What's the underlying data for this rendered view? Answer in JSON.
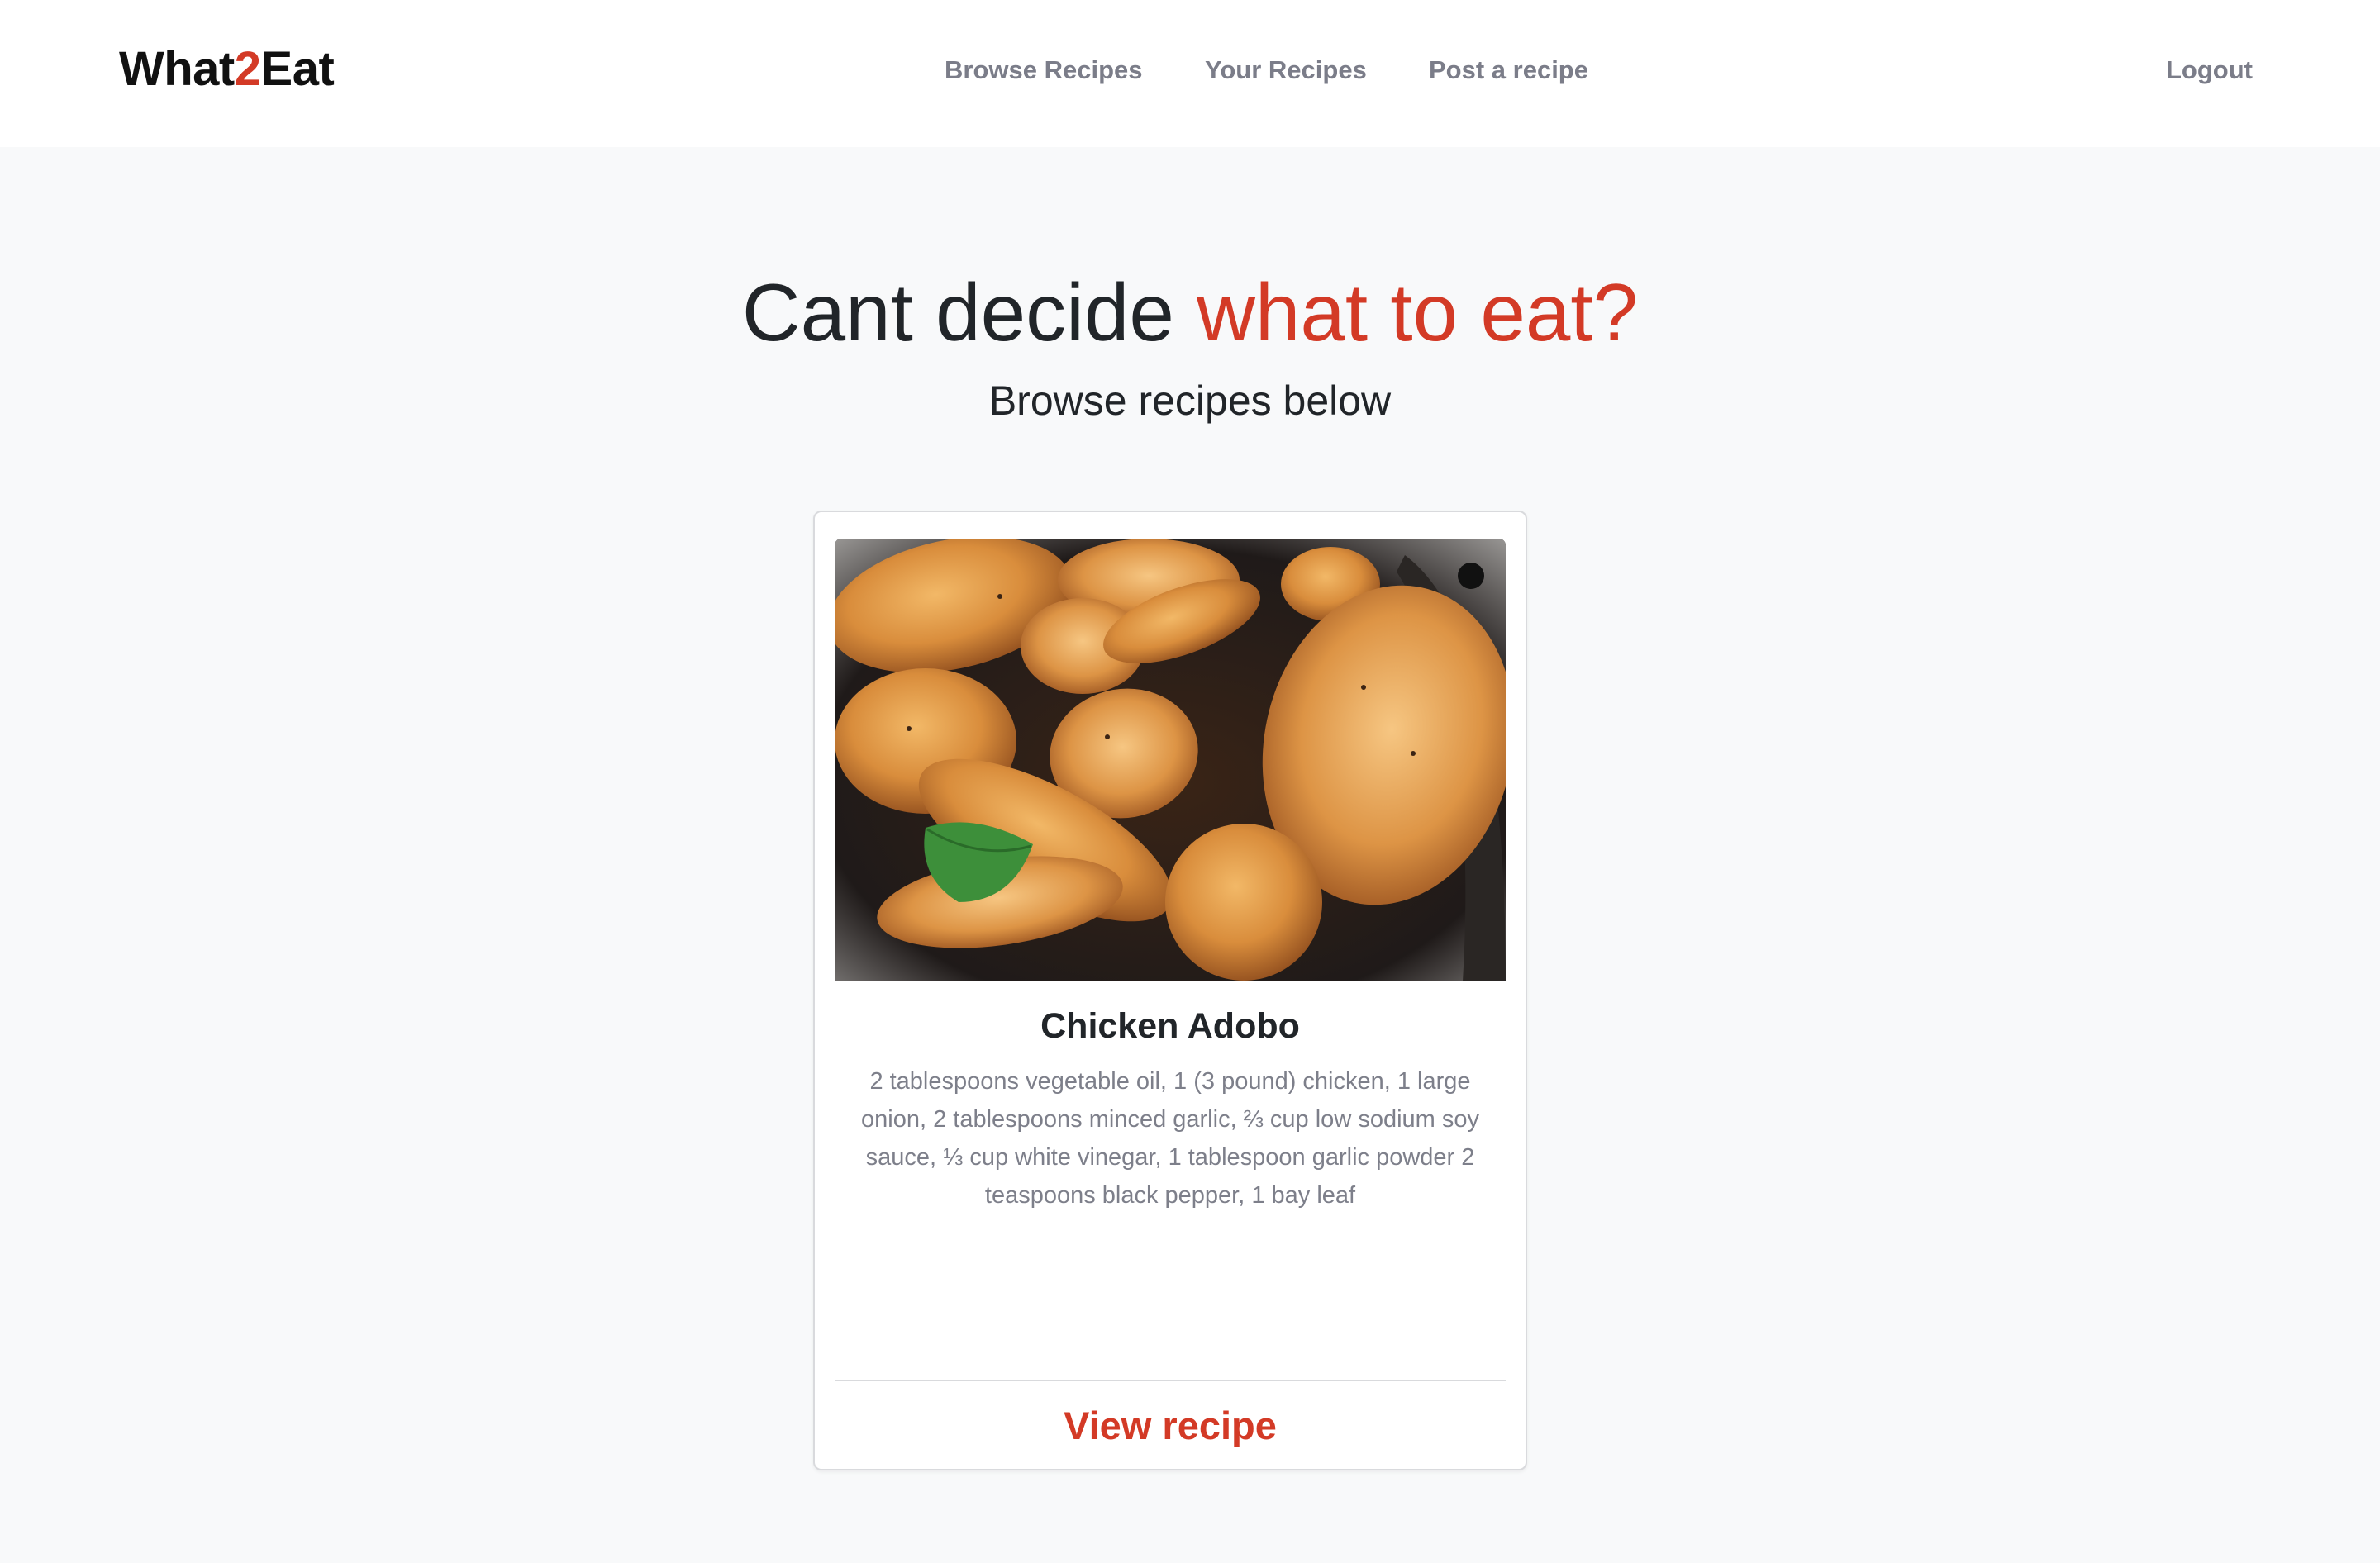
{
  "brand": {
    "part1": "What",
    "part2": "2",
    "part3": "Eat",
    "accent_color": "#d33a26"
  },
  "nav": {
    "links": [
      "Browse Recipes",
      "Your Recipes",
      "Post a recipe"
    ],
    "logout": "Logout"
  },
  "hero": {
    "title_plain": "Cant decide ",
    "title_accent": "what to eat?",
    "subtitle": "Browse recipes below"
  },
  "recipes": [
    {
      "image_icon": "chicken-adobo-photo",
      "title": "Chicken Adobo",
      "ingredients": "2 tablespoons vegetable oil, 1 (3 pound) chicken, 1 large onion, 2 tablespoons minced garlic, ⅔ cup low sodium soy sauce, ⅓ cup white vinegar, 1 tablespoon garlic powder 2 teaspoons black pepper, 1 bay leaf",
      "link_label": "View recipe"
    }
  ]
}
